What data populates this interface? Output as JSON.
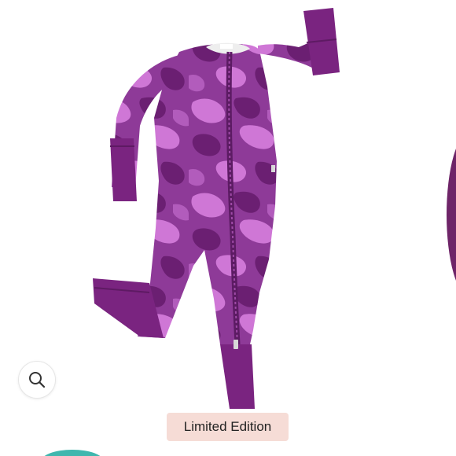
{
  "listing": {
    "badge_label": "Limited Edition"
  },
  "photo": {
    "subject_icon": "purple-camo-zip-romper-image"
  },
  "controls": {
    "zoom_icon": "magnifier-icon"
  },
  "colors": {
    "garment_base": "#8e3a98",
    "camo_light": "#cf77d6",
    "camo_dark": "#6b1f72",
    "cuff": "#7a2480",
    "badge_bg": "#f6dcd6",
    "teal_peek": "#3fb7ae"
  }
}
